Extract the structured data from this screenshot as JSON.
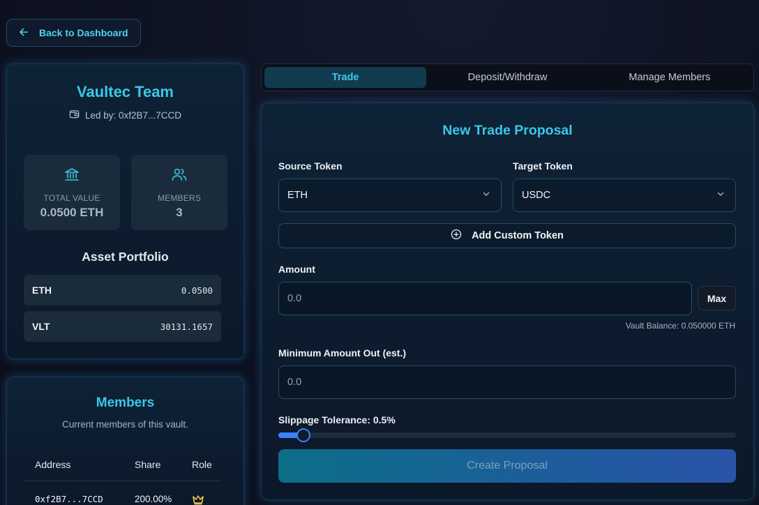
{
  "back_button": {
    "label": "Back to Dashboard",
    "icon": "arrow-left-icon"
  },
  "vault": {
    "name": "Vaultec Team",
    "led_by": "Led by: 0xf2B7...7CCD",
    "stats": [
      {
        "label": "TOTAL VALUE",
        "value": "0.0500 ETH",
        "icon": "bank-icon"
      },
      {
        "label": "MEMBERS",
        "value": "3",
        "icon": "users-icon"
      }
    ],
    "portfolio_title": "Asset Portfolio",
    "assets": [
      {
        "symbol": "ETH",
        "amount": "0.0500"
      },
      {
        "symbol": "VLT",
        "amount": "30131.1657"
      }
    ]
  },
  "members": {
    "title": "Members",
    "subtitle": "Current members of this vault.",
    "columns": [
      "Address",
      "Share",
      "Role"
    ],
    "rows": [
      {
        "address": "0xf2B7...7CCD",
        "share": "200.00%",
        "role_icon": "crown-icon"
      }
    ]
  },
  "tabs": [
    {
      "label": "Trade",
      "active": true
    },
    {
      "label": "Deposit/Withdraw",
      "active": false
    },
    {
      "label": "Manage Members",
      "active": false
    }
  ],
  "trade": {
    "title": "New Trade Proposal",
    "source_label": "Source Token",
    "source_value": "ETH",
    "target_label": "Target Token",
    "target_value": "USDC",
    "add_custom_token": "Add Custom Token",
    "amount_label": "Amount",
    "amount_placeholder": "0.0",
    "max_label": "Max",
    "vault_balance": "Vault Balance: 0.050000 ETH",
    "min_out_label": "Minimum Amount Out (est.)",
    "min_out_placeholder": "0.0",
    "slippage_label": "Slippage Tolerance: 0.5%",
    "slippage_fraction": 0.04,
    "create_label": "Create Proposal"
  },
  "colors": {
    "accent": "#3cc8e6",
    "slider": "#3b82f6",
    "crown": "#e8c547"
  }
}
